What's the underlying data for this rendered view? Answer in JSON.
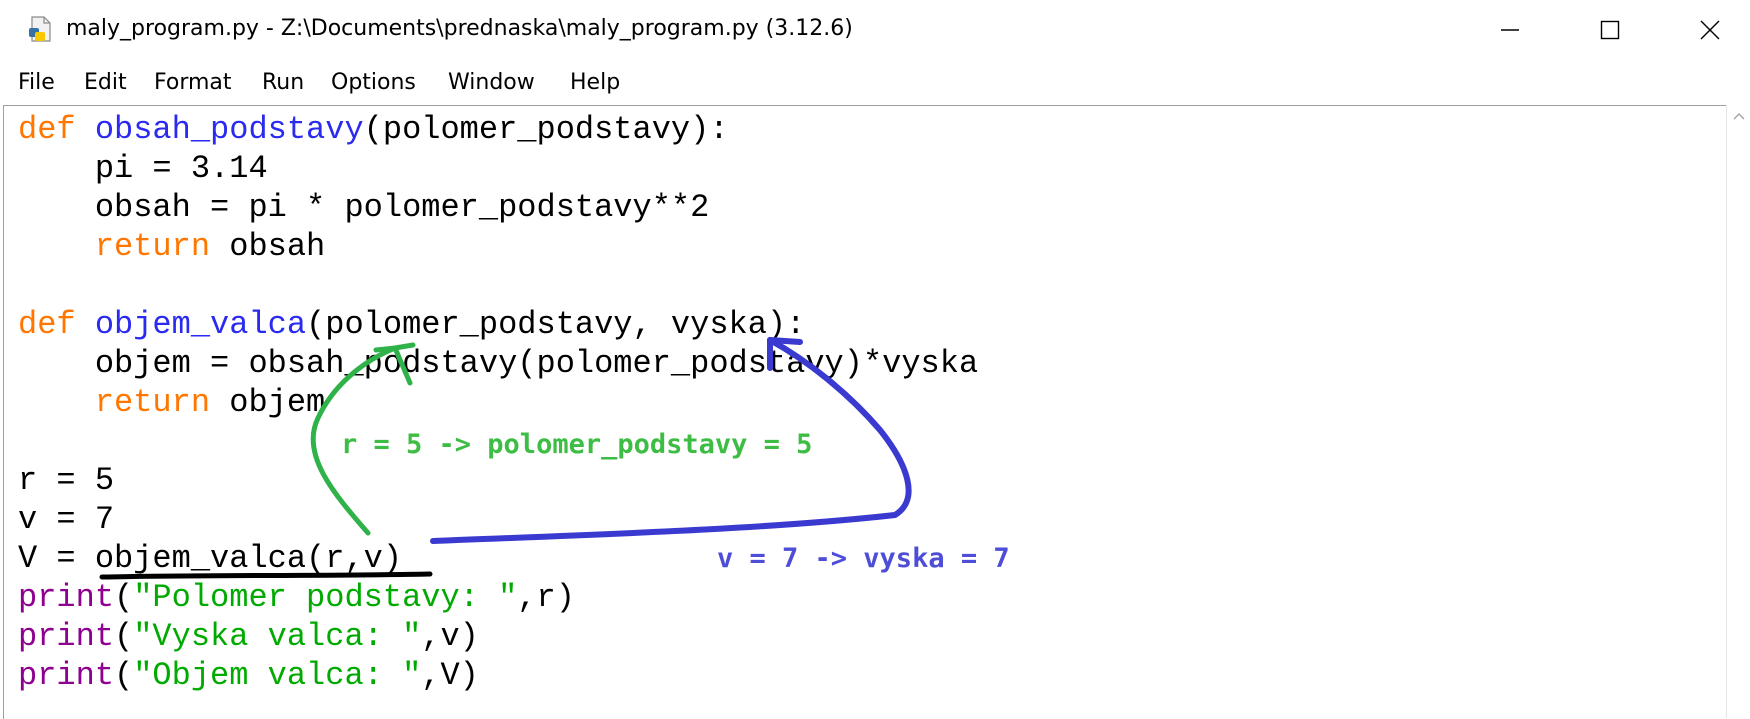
{
  "window": {
    "title": "maly_program.py - Z:\\Documents\\prednaska\\maly_program.py (3.12.6)",
    "app_icon": "python-file-icon",
    "controls": [
      "minimize-icon",
      "maximize-icon",
      "close-icon"
    ]
  },
  "menu": {
    "items": [
      "File",
      "Edit",
      "Format",
      "Run",
      "Options",
      "Window",
      "Help"
    ]
  },
  "editor": {
    "syntax_colors": {
      "keyword": "#ff7700",
      "definition": "#2a2af0",
      "builtin": "#900090",
      "string": "#00aa00",
      "default": "#000000"
    },
    "lines": [
      [
        {
          "t": "def",
          "c": "kw"
        },
        {
          "t": " "
        },
        {
          "t": "obsah_podstavy",
          "c": "fn"
        },
        {
          "t": "(polomer_podstavy):"
        }
      ],
      [
        {
          "t": "    pi = 3.14"
        }
      ],
      [
        {
          "t": "    obsah = pi * polomer_podstavy**2"
        }
      ],
      [
        {
          "t": "    "
        },
        {
          "t": "return",
          "c": "kw"
        },
        {
          "t": " obsah"
        }
      ],
      [
        {
          "t": ""
        }
      ],
      [
        {
          "t": "def",
          "c": "kw"
        },
        {
          "t": " "
        },
        {
          "t": "objem_valca",
          "c": "fn"
        },
        {
          "t": "(polomer_podstavy, vyska):"
        }
      ],
      [
        {
          "t": "    objem = obsah_podstavy(polomer_podstavy)*vyska"
        }
      ],
      [
        {
          "t": "    "
        },
        {
          "t": "return",
          "c": "kw"
        },
        {
          "t": " objem"
        }
      ],
      [
        {
          "t": ""
        }
      ],
      [
        {
          "t": "r = 5"
        }
      ],
      [
        {
          "t": "v = 7"
        }
      ],
      [
        {
          "t": "V = objem_valca(r,v)"
        }
      ],
      [
        {
          "t": "print",
          "c": "bi"
        },
        {
          "t": "("
        },
        {
          "t": "\"Polomer podstavy: \"",
          "c": "st"
        },
        {
          "t": ",r)"
        }
      ],
      [
        {
          "t": "print",
          "c": "bi"
        },
        {
          "t": "("
        },
        {
          "t": "\"Vyska valca: \"",
          "c": "st"
        },
        {
          "t": ",v)"
        }
      ],
      [
        {
          "t": "print",
          "c": "bi"
        },
        {
          "t": "("
        },
        {
          "t": "\"Objem valca: \"",
          "c": "st"
        },
        {
          "t": ",V)"
        }
      ]
    ]
  },
  "annotations": {
    "green_label": "r = 5 -> polomer_podstavy = 5",
    "green_color": "#3dbd44",
    "blue_label": "v = 7 -> vyska = 7",
    "blue_color": "#4d4dd8",
    "underline_color": "#000000"
  },
  "scrollbar": {
    "icon": "chevron-up-icon"
  }
}
